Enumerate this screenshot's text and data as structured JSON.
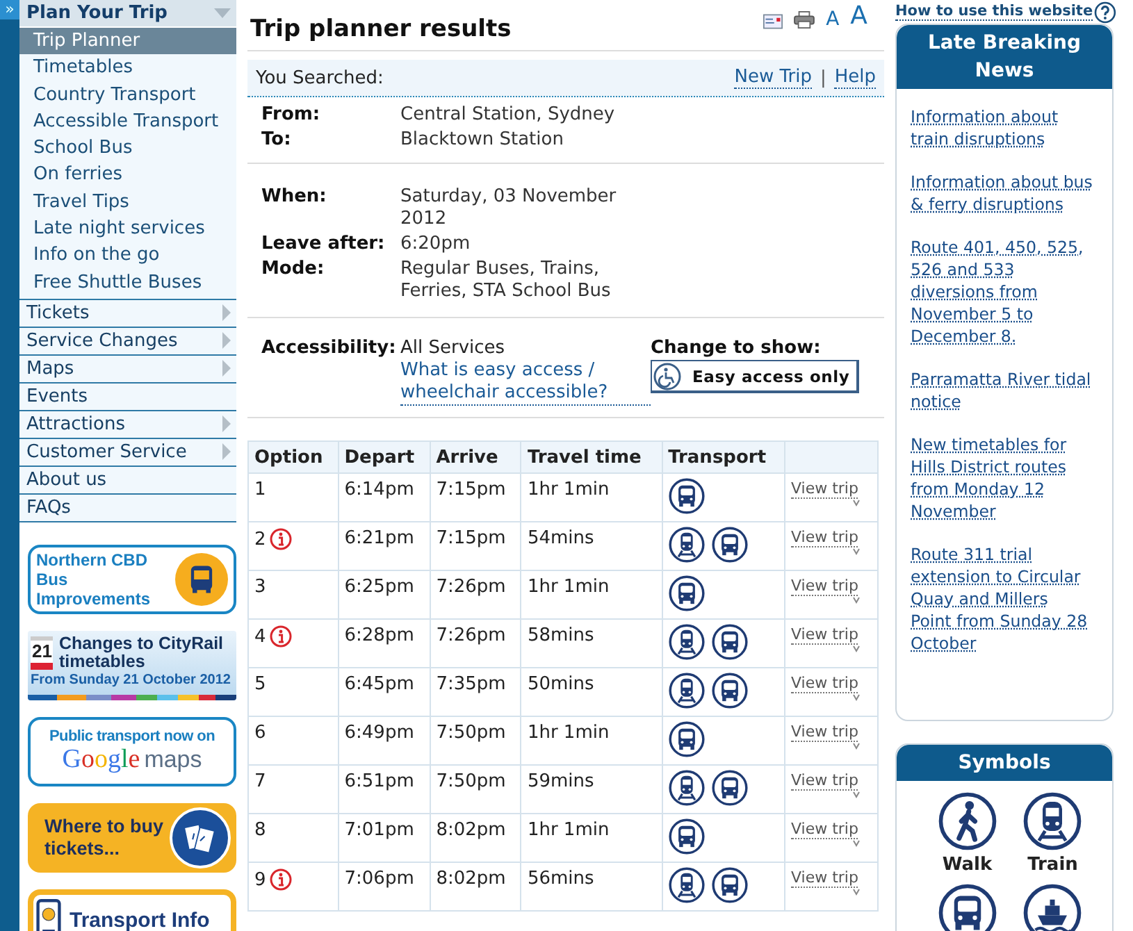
{
  "sidebar": {
    "collapse_glyph": "»",
    "section": {
      "label": "Plan Your Trip",
      "expanded": true,
      "items": [
        {
          "label": "Trip Planner",
          "selected": true
        },
        {
          "label": "Timetables",
          "selected": false
        },
        {
          "label": "Country Transport",
          "selected": false
        },
        {
          "label": "Accessible Transport",
          "selected": false
        },
        {
          "label": "School Bus",
          "selected": false
        },
        {
          "label": "On ferries",
          "selected": false
        },
        {
          "label": "Travel Tips",
          "selected": false
        },
        {
          "label": "Late night services",
          "selected": false
        },
        {
          "label": "Info on the go",
          "selected": false
        },
        {
          "label": "Free Shuttle Buses",
          "selected": false
        }
      ]
    },
    "menu": [
      {
        "label": "Tickets",
        "has_submenu": true
      },
      {
        "label": "Service Changes",
        "has_submenu": true
      },
      {
        "label": "Maps",
        "has_submenu": true
      },
      {
        "label": "Events",
        "has_submenu": false
      },
      {
        "label": "Attractions",
        "has_submenu": true
      },
      {
        "label": "Customer Service",
        "has_submenu": true
      },
      {
        "label": "About us",
        "has_submenu": false
      },
      {
        "label": "FAQs",
        "has_submenu": false
      }
    ],
    "banners": [
      {
        "kind": "bus_promo",
        "text": "Northern CBD Bus Improvements"
      },
      {
        "kind": "calendar",
        "day": "21",
        "title": "Changes to CityRail timetables",
        "subtitle": "From Sunday 21 October 2012"
      },
      {
        "kind": "maps",
        "text": "Public transport now on",
        "brand": "Google",
        "suffix": "maps"
      },
      {
        "kind": "tickets",
        "text": "Where to buy tickets..."
      },
      {
        "kind": "info",
        "text": "Transport Info"
      }
    ]
  },
  "main": {
    "title": "Trip planner results",
    "text_sizes": [
      "A",
      "A"
    ],
    "searched": {
      "label": "You Searched:",
      "links": [
        "New Trip",
        "Help"
      ],
      "separator": "|"
    },
    "details": [
      [
        {
          "label": "From:",
          "value": "Central Station, Sydney"
        },
        {
          "label": "To:",
          "value": "Blacktown Station"
        }
      ],
      [
        {
          "label": "When:",
          "value": "Saturday, 03 November 2012"
        },
        {
          "label": "Leave after:",
          "value": "6:20pm"
        },
        {
          "label": "Mode:",
          "value": "Regular Buses, Trains, Ferries, STA School Bus"
        }
      ]
    ],
    "accessibility": {
      "label": "Accessibility:",
      "value": "All Services",
      "link": "What is easy access / wheelchair accessible?",
      "change_label": "Change to show:",
      "button": "Easy access only"
    },
    "table": {
      "columns": [
        "Option",
        "Depart",
        "Arrive",
        "Travel time",
        "Transport"
      ],
      "rows": [
        {
          "option": "1",
          "alert": false,
          "depart": "6:14pm",
          "arrive": "7:15pm",
          "duration": "1hr 1min",
          "modes": [
            {
              "kind": "bus"
            }
          ],
          "link": "View trip"
        },
        {
          "option": "2",
          "alert": true,
          "depart": "6:21pm",
          "arrive": "7:15pm",
          "duration": "54mins",
          "modes": [
            {
              "kind": "train"
            },
            {
              "kind": "bus"
            }
          ],
          "link": "View trip"
        },
        {
          "option": "3",
          "alert": false,
          "depart": "6:25pm",
          "arrive": "7:26pm",
          "duration": "1hr 1min",
          "modes": [
            {
              "kind": "bus"
            }
          ],
          "link": "View trip"
        },
        {
          "option": "4",
          "alert": true,
          "depart": "6:28pm",
          "arrive": "7:26pm",
          "duration": "58mins",
          "modes": [
            {
              "kind": "train"
            },
            {
              "kind": "bus"
            }
          ],
          "link": "View trip"
        },
        {
          "option": "5",
          "alert": false,
          "depart": "6:45pm",
          "arrive": "7:35pm",
          "duration": "50mins",
          "modes": [
            {
              "kind": "train"
            },
            {
              "kind": "bus"
            }
          ],
          "link": "View trip"
        },
        {
          "option": "6",
          "alert": false,
          "depart": "6:49pm",
          "arrive": "7:50pm",
          "duration": "1hr 1min",
          "modes": [
            {
              "kind": "bus"
            }
          ],
          "link": "View trip"
        },
        {
          "option": "7",
          "alert": false,
          "depart": "6:51pm",
          "arrive": "7:50pm",
          "duration": "59mins",
          "modes": [
            {
              "kind": "train"
            },
            {
              "kind": "bus"
            }
          ],
          "link": "View trip"
        },
        {
          "option": "8",
          "alert": false,
          "depart": "7:01pm",
          "arrive": "8:02pm",
          "duration": "1hr 1min",
          "modes": [
            {
              "kind": "bus"
            }
          ],
          "link": "View trip"
        },
        {
          "option": "9",
          "alert": true,
          "depart": "7:06pm",
          "arrive": "8:02pm",
          "duration": "56mins",
          "modes": [
            {
              "kind": "train"
            },
            {
              "kind": "bus"
            }
          ],
          "link": "View trip"
        }
      ]
    }
  },
  "aside": {
    "help_link": "How to use this website",
    "news": {
      "title": "Late Breaking News",
      "items": [
        "Information about train disruptions",
        "Information about bus & ferry disruptions",
        "Route 401, 450, 525, 526 and 533 diversions from November 5 to December 8.",
        "Parramatta River tidal notice",
        "New timetables for Hills District routes from Monday 12 November",
        "Route 311 trial extension to Circular Quay and Millers Point from Sunday 28 October"
      ]
    },
    "symbols": {
      "title": "Symbols",
      "items": [
        {
          "kind": "walk",
          "label": "Walk"
        },
        {
          "kind": "train",
          "label": "Train"
        },
        {
          "kind": "bus"
        },
        {
          "kind": "ferry"
        }
      ]
    }
  }
}
